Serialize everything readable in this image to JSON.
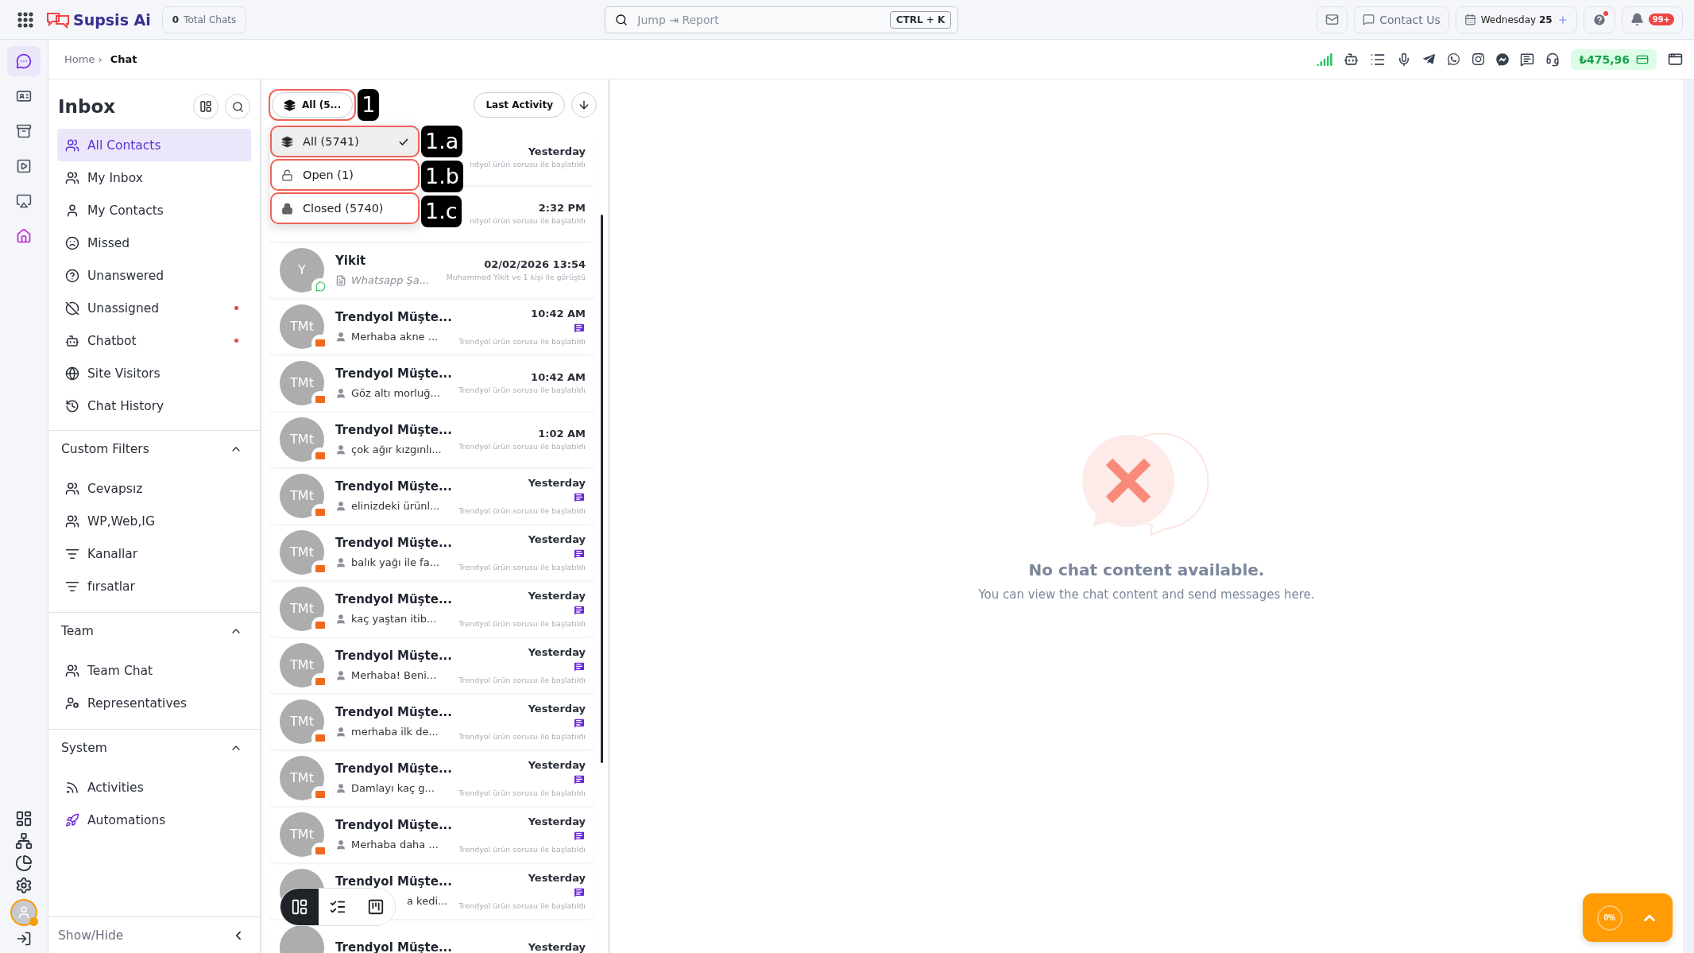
{
  "topbar": {
    "logo": "Supsis Ai",
    "total_chats": {
      "count": "0",
      "label": "Total Chats"
    },
    "search": {
      "placeholder": "Jump ⇥ Report",
      "shortcut": "CTRL + K"
    },
    "contact": "Contact Us",
    "date": {
      "day": "Wednesday",
      "num": "25"
    },
    "notifications": "99+"
  },
  "breadcrumb": {
    "items": [
      "Home ›"
    ],
    "current": "Chat"
  },
  "balance": "₺475,96",
  "rail": {
    "top": [
      {
        "selected": true
      },
      {
        "selected": false
      },
      {
        "selected": false
      },
      {
        "selected": false
      },
      {
        "selected": false
      },
      {
        "selected": false
      }
    ]
  },
  "inbox": {
    "title": "Inbox",
    "items": [
      {
        "label": "All Contacts",
        "selected": true,
        "dot": false
      },
      {
        "label": "My Inbox",
        "selected": false,
        "dot": false
      },
      {
        "label": "My Contacts",
        "selected": false,
        "dot": false
      },
      {
        "label": "Missed",
        "selected": false,
        "dot": false
      },
      {
        "label": "Unanswered",
        "selected": false,
        "dot": false
      },
      {
        "label": "Unassigned",
        "selected": false,
        "dot": true
      },
      {
        "label": "Chatbot",
        "selected": false,
        "dot": true
      },
      {
        "label": "Site Visitors",
        "selected": false,
        "dot": false
      },
      {
        "label": "Chat History",
        "selected": false,
        "dot": false
      }
    ],
    "sections": [
      {
        "title": "Custom Filters",
        "expanded": true,
        "items": [
          "Cevapsız",
          "WP,Web,IG",
          "Kanallar",
          "fırsatlar"
        ]
      },
      {
        "title": "Team",
        "expanded": true,
        "items": [
          "Team Chat",
          "Representatives"
        ]
      },
      {
        "title": "System",
        "expanded": true,
        "items": [
          "Activities",
          "Automations"
        ]
      }
    ],
    "show_hide": "Show/Hide"
  },
  "list": {
    "filter": {
      "label": "All (5...",
      "callout": "1"
    },
    "sort": "Last Activity",
    "dropdown": [
      {
        "label": "All (5741)",
        "selected": true,
        "callout": "1.a"
      },
      {
        "label": "Open (1)",
        "selected": false,
        "callout": "1.b"
      },
      {
        "label": "Closed (5740)",
        "selected": false,
        "callout": "1.c"
      }
    ],
    "rows": [
      {
        "kind": "covered",
        "time": "Yesterday",
        "note": "ndyol ürün sorusu ile başlatıldı"
      },
      {
        "kind": "covered",
        "time": "2:32 PM",
        "note": "ndyol ürün sorusu ile başlatıldı"
      },
      {
        "kind": "full",
        "initials": "Y",
        "badge": {
          "kind": "chat"
        },
        "name": "Yikit",
        "preview": "Whatsapp Şa...",
        "italic": true,
        "time": "02/02/2026 13:54",
        "unread": false,
        "note": "Muhammed Yikit ve 1 kişi ile görüştü"
      },
      {
        "kind": "full",
        "initials": "TMt",
        "badge": {
          "kind": "store"
        },
        "name": "Trendyol Müşte...",
        "preview": "Merhaba akne ...",
        "italic": false,
        "time": "10:42 AM",
        "unread": true,
        "note": "Trendyol ürün sorusu ile başlatıldı"
      },
      {
        "kind": "full",
        "initials": "TMt",
        "badge": {
          "kind": "store"
        },
        "name": "Trendyol Müşte...",
        "preview": "Göz altı morluğ...",
        "italic": false,
        "time": "10:42 AM",
        "unread": false,
        "note": "Trendyol ürün sorusu ile başlatıldı"
      },
      {
        "kind": "full",
        "initials": "TMt",
        "badge": {
          "kind": "store"
        },
        "name": "Trendyol Müşte...",
        "preview": "çok ağır kızgınlı...",
        "italic": false,
        "time": "1:02 AM",
        "unread": false,
        "note": "Trendyol ürün sorusu ile başlatıldı"
      },
      {
        "kind": "full",
        "initials": "TMt",
        "badge": {
          "kind": "store"
        },
        "name": "Trendyol Müşte...",
        "preview": "elinizdeki ürünl...",
        "italic": false,
        "time": "Yesterday",
        "unread": true,
        "note": "Trendyol ürün sorusu ile başlatıldı"
      },
      {
        "kind": "full",
        "initials": "TMt",
        "badge": {
          "kind": "store"
        },
        "name": "Trendyol Müşte...",
        "preview": "balık yağı ile fa...",
        "italic": false,
        "time": "Yesterday",
        "unread": true,
        "note": "Trendyol ürün sorusu ile başlatıldı"
      },
      {
        "kind": "full",
        "initials": "TMt",
        "badge": {
          "kind": "store"
        },
        "name": "Trendyol Müşte...",
        "preview": "kaç yaştan itib...",
        "italic": false,
        "time": "Yesterday",
        "unread": true,
        "note": "Trendyol ürün sorusu ile başlatıldı"
      },
      {
        "kind": "full",
        "initials": "TMt",
        "badge": {
          "kind": "store"
        },
        "name": "Trendyol Müşte...",
        "preview": "Merhaba! Beni...",
        "italic": false,
        "time": "Yesterday",
        "unread": true,
        "note": "Trendyol ürün sorusu ile başlatıldı"
      },
      {
        "kind": "full",
        "initials": "TMt",
        "badge": {
          "kind": "store"
        },
        "name": "Trendyol Müşte...",
        "preview": "merhaba ilk de...",
        "italic": false,
        "time": "Yesterday",
        "unread": true,
        "note": "Trendyol ürün sorusu ile başlatıldı"
      },
      {
        "kind": "full",
        "initials": "TMt",
        "badge": {
          "kind": "store"
        },
        "name": "Trendyol Müşte...",
        "preview": "Damlayı kaç g...",
        "italic": false,
        "time": "Yesterday",
        "unread": true,
        "note": "Trendyol ürün sorusu ile başlatıldı"
      },
      {
        "kind": "full",
        "initials": "TMt",
        "badge": {
          "kind": "store"
        },
        "name": "Trendyol Müşte...",
        "preview": "Merhaba daha ...",
        "italic": false,
        "time": "Yesterday",
        "unread": true,
        "note": "Trendyol ürün sorusu ile başlatıldı"
      },
      {
        "kind": "underbar",
        "name": "Trendyol Müşte...",
        "preview": "a kedi...",
        "time": "Yesterday",
        "unread": true,
        "note": "Trendyol ürün sorusu ile başlatıldı"
      },
      {
        "kind": "cut",
        "name": "Trendyol Müşte...",
        "time": "Yesterday"
      }
    ],
    "view_modes": [
      {
        "selected": true
      },
      {
        "selected": false
      },
      {
        "selected": false
      }
    ]
  },
  "empty": {
    "title": "No chat content available.",
    "text": "You can view the chat content and send messages here."
  },
  "widget": {
    "percent": "0%"
  }
}
